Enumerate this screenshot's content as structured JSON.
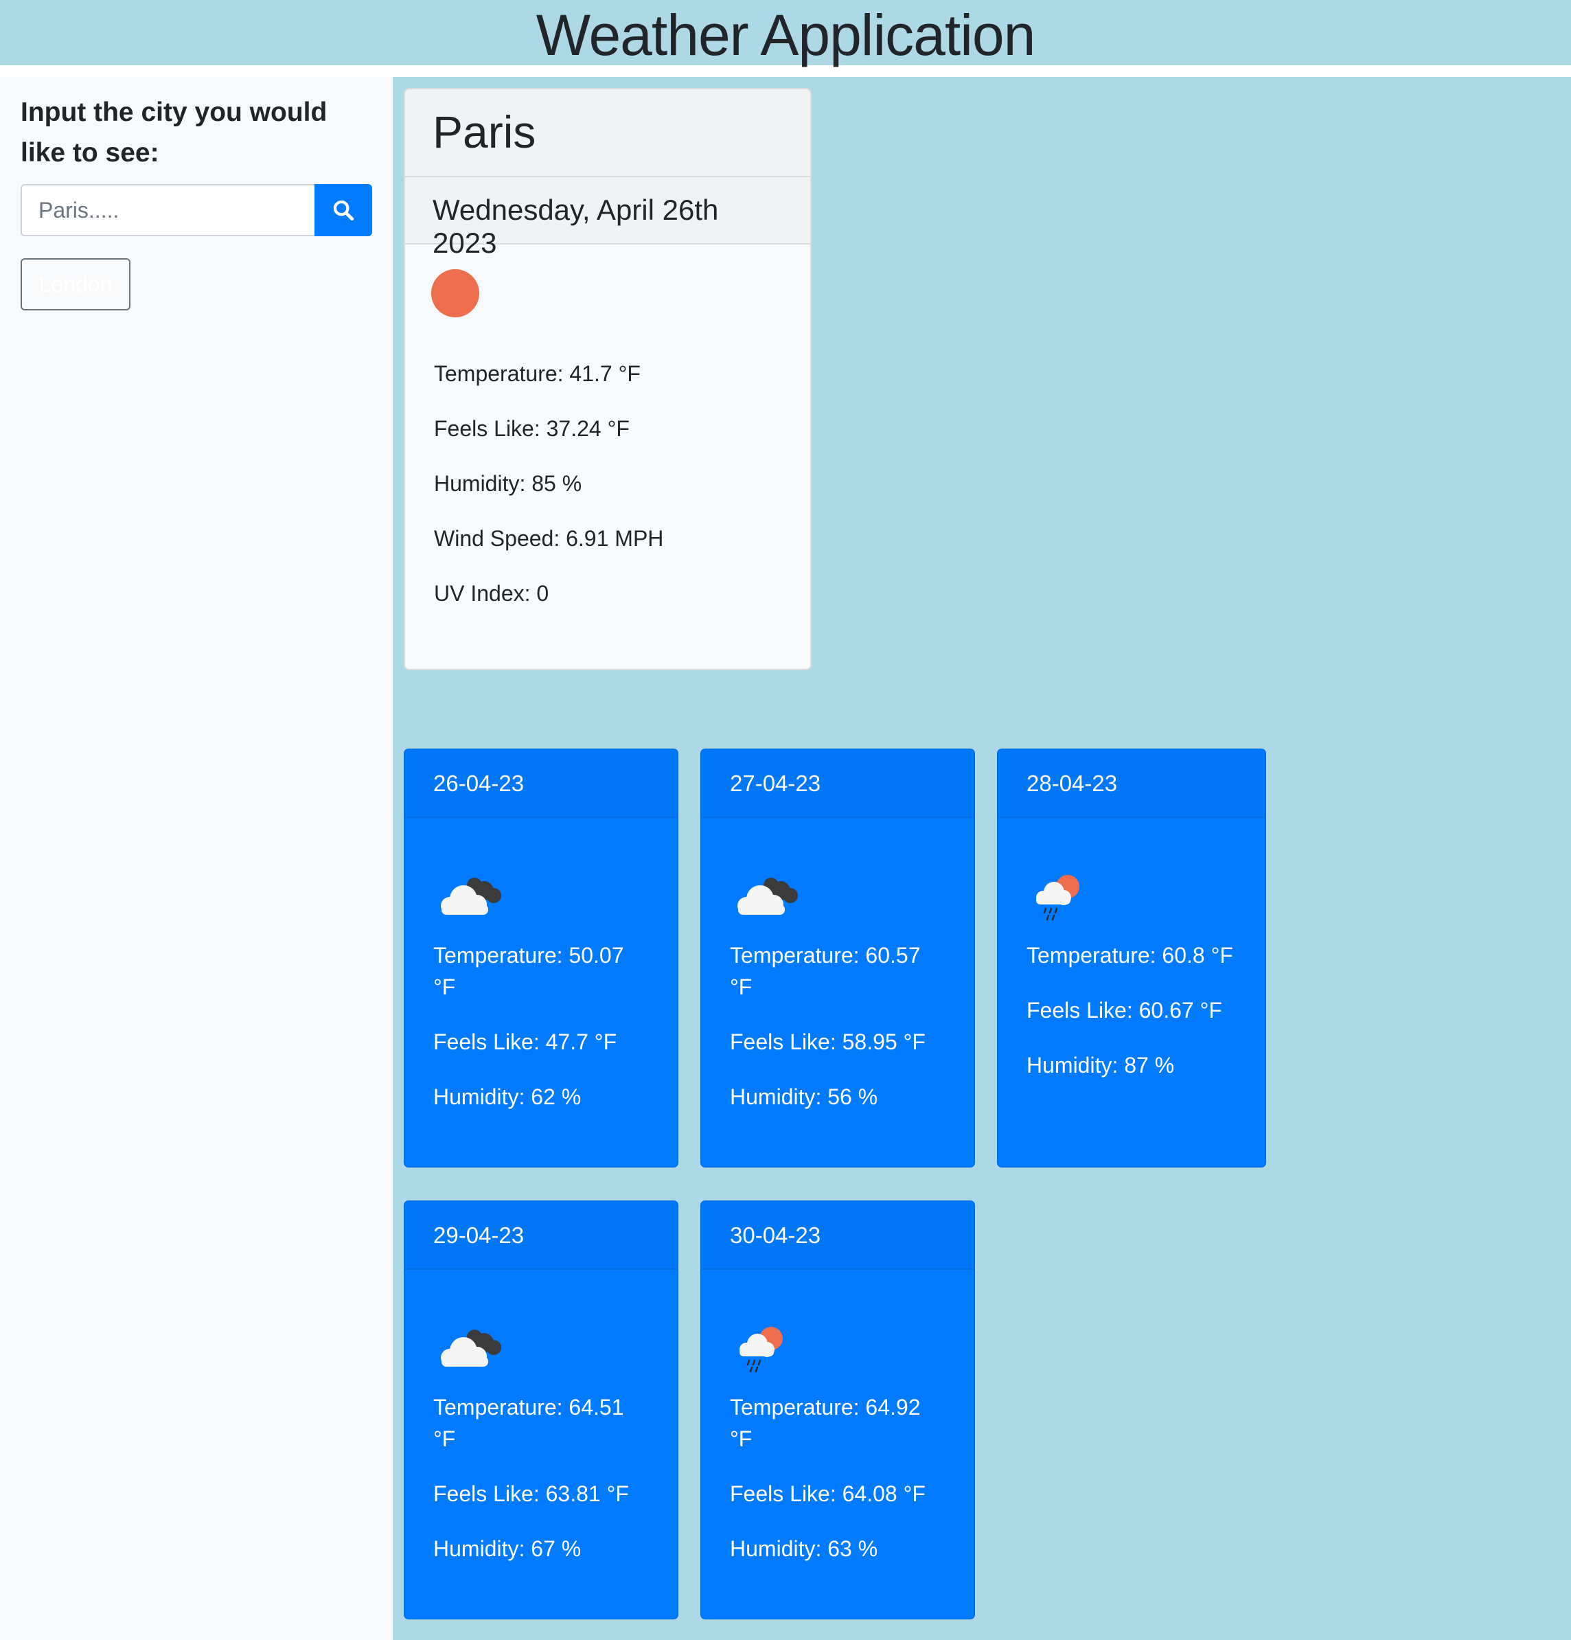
{
  "header": {
    "title": "Weather Application"
  },
  "sidebar": {
    "prompt": "Input the city you would like to see:",
    "search": {
      "placeholder": "Paris.....",
      "value": ""
    },
    "history": [
      "London"
    ]
  },
  "current": {
    "city": "Paris",
    "date": "Wednesday, April 26th 2023",
    "icon": "sun-icon",
    "temperature": "Temperature: 41.7 °F",
    "feels_like": "Feels Like: 37.24 °F",
    "humidity": "Humidity: 85 %",
    "wind_speed": "Wind Speed: 6.91 MPH",
    "uv_index": "UV Index: 0"
  },
  "forecast": [
    {
      "date": "26-04-23",
      "icon": "cloudy-icon",
      "temperature": "Temperature: 50.07 °F",
      "feels_like": "Feels Like: 47.7 °F",
      "humidity": "Humidity: 62 %"
    },
    {
      "date": "27-04-23",
      "icon": "cloudy-icon",
      "temperature": "Temperature: 60.57 °F",
      "feels_like": "Feels Like: 58.95 °F",
      "humidity": "Humidity: 56 %"
    },
    {
      "date": "28-04-23",
      "icon": "sun-rain-cloud-icon",
      "temperature": "Temperature: 60.8 °F",
      "feels_like": "Feels Like: 60.67 °F",
      "humidity": "Humidity: 87 %"
    },
    {
      "date": "29-04-23",
      "icon": "cloudy-icon",
      "temperature": "Temperature: 64.51 °F",
      "feels_like": "Feels Like: 63.81 °F",
      "humidity": "Humidity: 67 %"
    },
    {
      "date": "30-04-23",
      "icon": "sun-rain-cloud-icon",
      "temperature": "Temperature: 64.92 °F",
      "feels_like": "Feels Like: 64.08 °F",
      "humidity": "Humidity: 63 %"
    }
  ],
  "colors": {
    "header_bg": "#add8e6",
    "main_bg": "#add8e6",
    "sidebar_bg": "#f8f9fa",
    "primary": "#007bff",
    "sun": "#ec6e4c"
  }
}
